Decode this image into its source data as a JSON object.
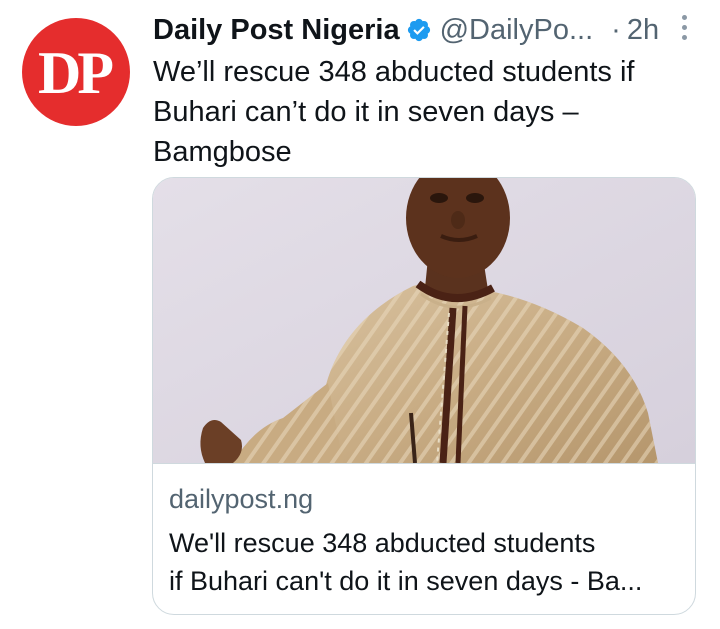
{
  "tweet": {
    "author_name": "Daily Post Nigeria",
    "author_handle": "@DailyPo...",
    "separator": "·",
    "time": "2h",
    "avatar_text": "DP",
    "text_lines": [
      "We’ll rescue 348 abducted students if",
      "Buhari can’t do it in seven days –",
      "Bamgbose"
    ]
  },
  "card": {
    "domain": "dailypost.ng",
    "title_lines": [
      "We'll rescue 348 abducted students",
      "if Buhari can't do it in seven days - Ba..."
    ]
  },
  "colors": {
    "avatar": "#e52d2d",
    "verified": "#1d9bf0",
    "secondary_text": "#536471",
    "border": "#cfd9de"
  },
  "icons": {
    "verified": "verified-badge-icon",
    "more": "more-vertical-icon"
  }
}
